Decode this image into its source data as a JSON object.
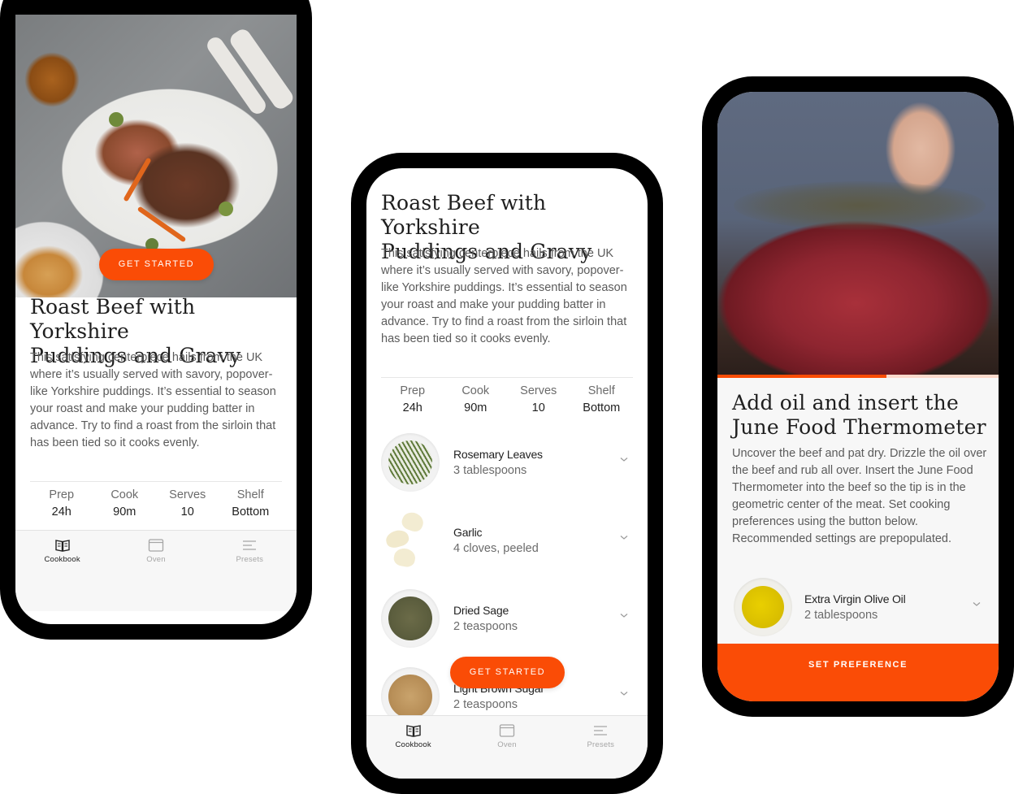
{
  "brand": {
    "accent": "#fa4c06"
  },
  "recipe": {
    "title_line1": "Roast Beef with Yorkshire",
    "title_line2": "Puddings and Gravy",
    "description": "This satisfying centerpiece hails from the UK where it’s usually served with savory, popover-like Yorkshire puddings. It’s essential to season your roast and make your pudding batter in advance. Try to find a roast from the sirloin that has been tied so it cooks evenly.",
    "stats": [
      {
        "label": "Prep",
        "value": "24h"
      },
      {
        "label": "Cook",
        "value": "90m"
      },
      {
        "label": "Serves",
        "value": "10"
      },
      {
        "label": "Shelf",
        "value": "Bottom"
      }
    ],
    "cta_label": "GET STARTED"
  },
  "ingredients": [
    {
      "name": "Rosemary Leaves",
      "quantity": "3 tablespoons",
      "icon": "rosemary-icon"
    },
    {
      "name": "Garlic",
      "quantity": "4 cloves, peeled",
      "icon": "garlic-icon"
    },
    {
      "name": "Dried Sage",
      "quantity": "2 teaspoons",
      "icon": "sage-icon"
    },
    {
      "name": "Light Brown Sugar",
      "quantity": "2 teaspoons",
      "icon": "brown-sugar-icon"
    }
  ],
  "tabbar": {
    "tabs": [
      {
        "label": "Cookbook",
        "icon": "book-icon",
        "active": true
      },
      {
        "label": "Oven",
        "icon": "oven-icon",
        "active": false
      },
      {
        "label": "Presets",
        "icon": "menu-lines-icon",
        "active": false
      }
    ]
  },
  "step": {
    "title_line1": "Add oil and insert the",
    "title_line2": "June Food Thermometer",
    "description": "Uncover the beef and pat dry. Drizzle the oil over the beef and rub all over. Insert the June Food Thermometer into the beef so the tip is in the geometric center of the meat. Set cooking preferences using the button below. Recommended settings are prepopulated.",
    "progress_percent": 60,
    "ingredient": {
      "name": "Extra Virgin Olive Oil",
      "quantity": "2 tablespoons",
      "icon": "olive-oil-icon"
    },
    "cta_label": "SET PREFERENCE"
  }
}
